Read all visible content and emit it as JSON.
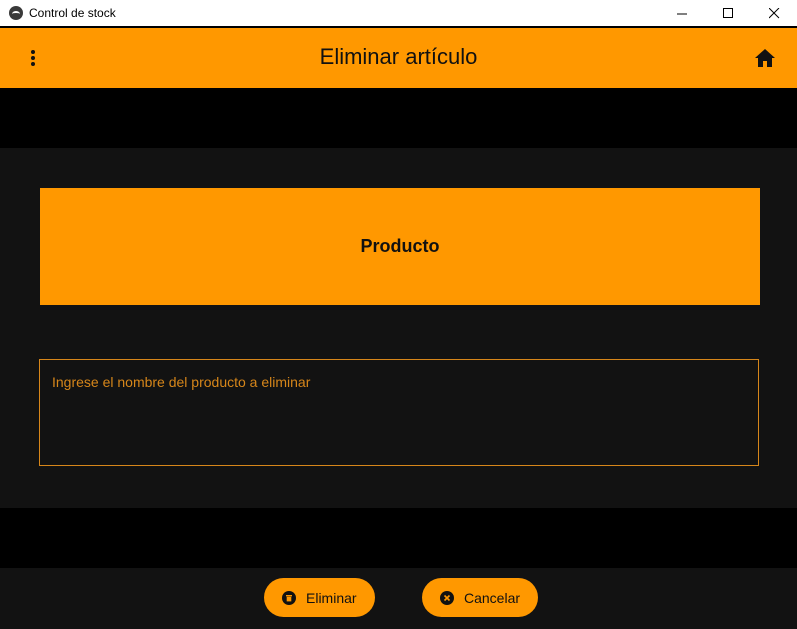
{
  "window": {
    "title": "Control de stock",
    "minimize_glyph": "—",
    "maximize_glyph": "☐",
    "close_glyph": "✕"
  },
  "appbar": {
    "title": "Eliminar artículo",
    "menu_icon": "more-vert-icon",
    "home_icon": "home-icon"
  },
  "header": {
    "label": "Producto"
  },
  "product_input": {
    "placeholder": "Ingrese el nombre del producto a eliminar",
    "value": ""
  },
  "actions": {
    "delete_label": "Eliminar",
    "delete_icon": "trash-icon",
    "cancel_label": "Cancelar",
    "cancel_icon": "close-circle-icon"
  },
  "colors": {
    "accent": "#ff9800",
    "background": "#000000",
    "panel": "#121212"
  }
}
